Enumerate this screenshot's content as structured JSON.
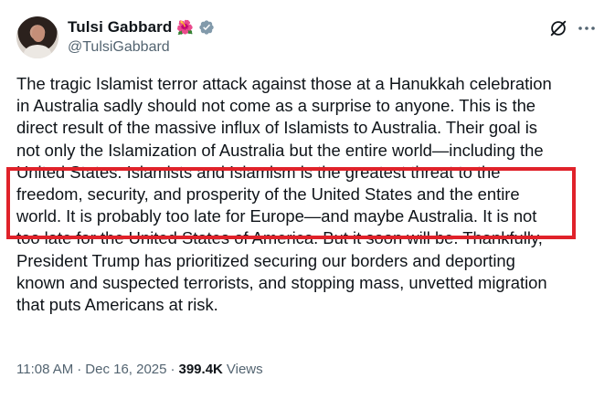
{
  "author": {
    "display_name": "Tulsi Gabbard",
    "emoji": "🌺",
    "handle": "@TulsiGabbard"
  },
  "icons": {
    "verified": "verified-badge-icon",
    "grok": "grok-icon",
    "more": "more-options-icon"
  },
  "tweet": {
    "text": "The tragic Islamist terror attack against those at a Hanukkah celebration\nin Australia sadly should not come as a surprise to anyone.  This is the\ndirect result of the massive influx of Islamists to Australia. Their goal is\nnot only the Islamization of Australia but the entire world—including the\nUnited States. Islamists and Islamism is the greatest threat to the\nfreedom, security, and prosperity of the United States and the entire\nworld. It is probably too late for Europe—and maybe Australia. It is not\ntoo late for the United States of America. But it soon will be. Thankfully,\nPresident Trump has prioritized securing our borders and deporting\nknown and suspected terrorists, and stopping mass, unvetted migration\nthat puts Americans at risk."
  },
  "meta": {
    "time": "11:08 AM",
    "sep1": "·",
    "date": "Dec 16, 2025",
    "sep2": "·",
    "views_count": "399.4K",
    "views_label": "Views"
  },
  "colors": {
    "highlight_border": "#e0222a",
    "verified_badge": "#829aab",
    "secondary_text": "#536471"
  }
}
